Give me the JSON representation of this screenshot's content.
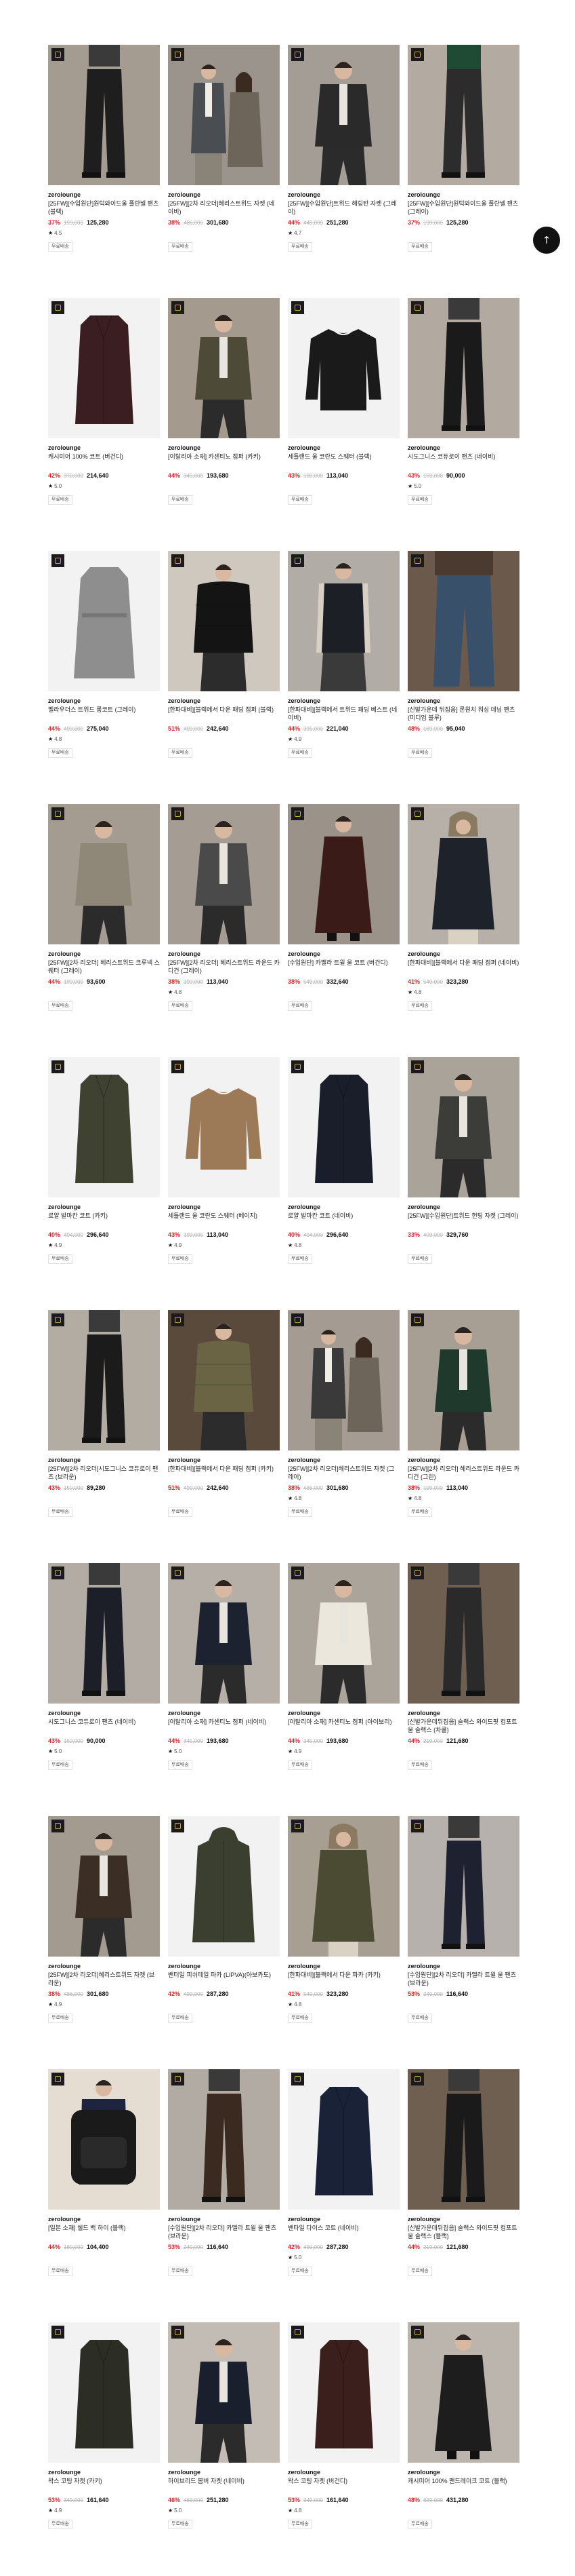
{
  "scroll_top": {
    "icon": "arrow-up-icon",
    "label": "↑"
  },
  "colors": {
    "discount": "#e0262b",
    "badge_bg": "#1b1b1b",
    "badge_border": "#c8a45a"
  },
  "products": [
    {
      "brand": "zerolounge",
      "name": "[25FW][수입원단]원턱와이드울 플란넬 팬츠 (블랙)",
      "discount": "37%",
      "original_price": "199,000",
      "price": "125,280",
      "rating": "4.5",
      "tag": "무료배송",
      "bg": "#a49c91",
      "garment": "pants-black",
      "fg": "#1e1e1e"
    },
    {
      "brand": "zerolounge",
      "name": "[25FW][2차 리오더]헤리스트위드 자켓 (네이비)",
      "discount": "38%",
      "original_price": "486,000",
      "price": "301,680",
      "rating": "",
      "tag": "무료배송",
      "bg": "#9a948c",
      "garment": "jacket-duo",
      "fg": "#4a4e53"
    },
    {
      "brand": "zerolounge",
      "name": "[25FW][수입원단]트위드 헤링턴 자켓 (그레이)",
      "discount": "44%",
      "original_price": "449,000",
      "price": "251,280",
      "rating": "4.7",
      "tag": "무료배송",
      "bg": "#a49d95",
      "garment": "jacket-dark",
      "fg": "#2a2a2a"
    },
    {
      "brand": "zerolounge",
      "name": "[25FW][수입원단]원턱와이드울 플란넬 팬츠 (그레이)",
      "discount": "37%",
      "original_price": "199,000",
      "price": "125,280",
      "rating": "",
      "tag": "무료배송",
      "bg": "#b3aba1",
      "garment": "pants-green",
      "fg": "#2c2c2c"
    },
    {
      "brand": "zerolounge",
      "name": "캐시미어 100% 코트 (버건디)",
      "discount": "42%",
      "original_price": "370,000",
      "price": "214,640",
      "rating": "5.0",
      "tag": "무료배송",
      "bg": "#f2f2f2",
      "garment": "coat-flat",
      "fg": "#3a1e22"
    },
    {
      "brand": "zerolounge",
      "name": "[이탈리아 소재] 카센티노 점퍼 (카키)",
      "discount": "44%",
      "original_price": "345,000",
      "price": "193,680",
      "rating": "",
      "tag": "무료배송",
      "bg": "#a49a8e",
      "garment": "jacket-model",
      "fg": "#4d4a37"
    },
    {
      "brand": "zerolounge",
      "name": "세틀랜드 울 코란도 스웨터 (블랙)",
      "discount": "43%",
      "original_price": "199,000",
      "price": "113,040",
      "rating": "",
      "tag": "무료배송",
      "bg": "#f2f2f2",
      "garment": "sweater-flat",
      "fg": "#1a1a1a"
    },
    {
      "brand": "zerolounge",
      "name": "시도그니스 코듀로이 팬츠 (네이비)",
      "discount": "43%",
      "original_price": "159,000",
      "price": "90,000",
      "rating": "5.0",
      "tag": "무료배송",
      "bg": "#b2aaa0",
      "garment": "pants-black",
      "fg": "#1a1a1a"
    },
    {
      "brand": "zerolounge",
      "name": "멜라우더스 트위드 롱코트 (그레이)",
      "discount": "44%",
      "original_price": "490,000",
      "price": "275,040",
      "rating": "4.8",
      "tag": "무료배송",
      "bg": "#f2f2f2",
      "garment": "coat-grey",
      "fg": "#8e8e8e"
    },
    {
      "brand": "zerolounge",
      "name": "[한파대비][블랙에서 다운 패딩 점퍼 (블랙)",
      "discount": "51%",
      "original_price": "499,000",
      "price": "242,640",
      "rating": "",
      "tag": "무료배송",
      "bg": "#cfc8be",
      "garment": "puffer-model",
      "fg": "#141414"
    },
    {
      "brand": "zerolounge",
      "name": "[한파대비][블랙에서 트위드 패딩 베스트 (네이비)",
      "discount": "44%",
      "original_price": "395,000",
      "price": "221,040",
      "rating": "4.9",
      "tag": "무료배송",
      "bg": "#b1aca5",
      "garment": "vest-model",
      "fg": "#1c1f26"
    },
    {
      "brand": "zerolounge",
      "name": "[신발가운데 뒤집음] 론원치 워싱 데님 팬츠 (미디엄 블루)",
      "discount": "48%",
      "original_price": "189,000",
      "price": "95,040",
      "rating": "",
      "tag": "무료배송",
      "bg": "#6b5a4b",
      "garment": "denim",
      "fg": "#39506b"
    },
    {
      "brand": "zerolounge",
      "name": "[25FW][2차 리오더] 헤리스트위드 크루넥 스웨터 (그레이)",
      "discount": "44%",
      "original_price": "199,000",
      "price": "93,600",
      "rating": "",
      "tag": "무료배송",
      "bg": "#a59c91",
      "garment": "sweater-model",
      "fg": "#8f8777"
    },
    {
      "brand": "zerolounge",
      "name": "[25FW][2차 리오더] 헤리스트위드 라운드 카디건 (그레이)",
      "discount": "38%",
      "original_price": "199,000",
      "price": "113,040",
      "rating": "4.8",
      "tag": "무료배송",
      "bg": "#a59d93",
      "garment": "cardigan-model",
      "fg": "#4a4a4a"
    },
    {
      "brand": "zerolounge",
      "name": "[수입원단] 카멜라 트윌 울 코트 (버건디)",
      "discount": "38%",
      "original_price": "549,000",
      "price": "332,640",
      "rating": "",
      "tag": "무료배송",
      "bg": "#9b938a",
      "garment": "coat-model",
      "fg": "#3b1b18"
    },
    {
      "brand": "zerolounge",
      "name": "[한파대비][블랙에서 다운 패딩 점퍼 (네이비)",
      "discount": "41%",
      "original_price": "549,000",
      "price": "323,280",
      "rating": "4.8",
      "tag": "무료배송",
      "bg": "#b6b0a8",
      "garment": "parka-model",
      "fg": "#1d222b"
    },
    {
      "brand": "zerolounge",
      "name": "로얄 발마칸 코트 (카키)",
      "discount": "40%",
      "original_price": "494,000",
      "price": "296,640",
      "rating": "4.9",
      "tag": "무료배송",
      "bg": "#f2f2f2",
      "garment": "coat-flat",
      "fg": "#3f4230"
    },
    {
      "brand": "zerolounge",
      "name": "세틀랜드 울 코란도 스웨터 (베이지)",
      "discount": "43%",
      "original_price": "199,000",
      "price": "113,040",
      "rating": "4.9",
      "tag": "무료배송",
      "bg": "#f2f2f2",
      "garment": "sweater-flat",
      "fg": "#9c7a58"
    },
    {
      "brand": "zerolounge",
      "name": "로얄 발마칸 코트 (네이비)",
      "discount": "40%",
      "original_price": "494,000",
      "price": "296,640",
      "rating": "4.8",
      "tag": "무료배송",
      "bg": "#f2f2f2",
      "garment": "coat-flat",
      "fg": "#1a1e2a"
    },
    {
      "brand": "zerolounge",
      "name": "[25FW][수입원단]트위드 헌팅 자켓 (그레이)",
      "discount": "33%",
      "original_price": "499,000",
      "price": "329,760",
      "rating": "",
      "tag": "무료배송",
      "bg": "#aaa39a",
      "garment": "jacket-model",
      "fg": "#3c3c38"
    },
    {
      "brand": "zerolounge",
      "name": "[25FW][2차 리오더]시도그니스 코듀로이 팬츠 (브라운)",
      "discount": "43%",
      "original_price": "159,000",
      "price": "89,280",
      "rating": "",
      "tag": "무료배송",
      "bg": "#b3aca3",
      "garment": "pants-black",
      "fg": "#1b1b1b"
    },
    {
      "brand": "zerolounge",
      "name": "[한파대비][블랙에서 다운 패딩 점퍼 (카키)",
      "discount": "51%",
      "original_price": "499,000",
      "price": "242,640",
      "rating": "",
      "tag": "무료배송",
      "bg": "#5a4a3c",
      "garment": "puffer-model",
      "fg": "#6a6444"
    },
    {
      "brand": "zerolounge",
      "name": "[25FW][2차 리오더]헤리스트위드 자켓 (그레이)",
      "discount": "38%",
      "original_price": "486,000",
      "price": "301,680",
      "rating": "4.8",
      "tag": "무료배송",
      "bg": "#a49c92",
      "garment": "jacket-duo",
      "fg": "#3a3a3a"
    },
    {
      "brand": "zerolounge",
      "name": "[25FW][2차 리오더] 헤리스트위드 라운드 카디건 (그린)",
      "discount": "38%",
      "original_price": "199,000",
      "price": "113,040",
      "rating": "4.8",
      "tag": "무료배송",
      "bg": "#a79f94",
      "garment": "cardigan-model",
      "fg": "#1f3a2c"
    },
    {
      "brand": "zerolounge",
      "name": "시도그니스 코듀로이 팬츠 (네이비)",
      "discount": "43%",
      "original_price": "159,000",
      "price": "90,000",
      "rating": "5.0",
      "tag": "무료배송",
      "bg": "#b3aca4",
      "garment": "pants-black",
      "fg": "#1c1f28"
    },
    {
      "brand": "zerolounge",
      "name": "[이탈리아 소재] 카센티노 점퍼 (네이비)",
      "discount": "44%",
      "original_price": "345,000",
      "price": "193,680",
      "rating": "5.0",
      "tag": "무료배송",
      "bg": "#b5afa7",
      "garment": "jacket-model",
      "fg": "#1d2230"
    },
    {
      "brand": "zerolounge",
      "name": "[이탈리아 소재] 카센티노 점퍼 (아이보리)",
      "discount": "44%",
      "original_price": "345,000",
      "price": "193,680",
      "rating": "4.9",
      "tag": "무료배송",
      "bg": "#aba49b",
      "garment": "jacket-model",
      "fg": "#ece7dd"
    },
    {
      "brand": "zerolounge",
      "name": "[신발가운데뒤집음] 슬랙스 와이드핏 컴포트 울 슬랙스 (차콜)",
      "discount": "44%",
      "original_price": "219,000",
      "price": "121,680",
      "rating": "",
      "tag": "무료배송",
      "bg": "#6e5f51",
      "garment": "pants-black",
      "fg": "#2a2a2a"
    },
    {
      "brand": "zerolounge",
      "name": "[25FW][2차 리오더]헤리스트위드 자켓 (브라운)",
      "discount": "38%",
      "original_price": "486,000",
      "price": "301,680",
      "rating": "4.9",
      "tag": "무료배송",
      "bg": "#a49b90",
      "garment": "jacket-model",
      "fg": "#3b2e24"
    },
    {
      "brand": "zerolounge",
      "name": "밴터일 피쉬테일 파카 (LIPVA)(아보카도)",
      "discount": "42%",
      "original_price": "490,000",
      "price": "287,280",
      "rating": "",
      "tag": "무료배송",
      "bg": "#f2f2f2",
      "garment": "parka-flat",
      "fg": "#3b3f30"
    },
    {
      "brand": "zerolounge",
      "name": "[한파대비][블랙에서 다운 파카 (카키)",
      "discount": "41%",
      "original_price": "549,000",
      "price": "323,280",
      "rating": "4.8",
      "tag": "무료배송",
      "bg": "#a89f93",
      "garment": "parka-model",
      "fg": "#4b4a33"
    },
    {
      "brand": "zerolounge",
      "name": "[수입원단][2차 리오더] 카멜라 트윌 울 팬츠 (브라운)",
      "discount": "53%",
      "original_price": "249,000",
      "price": "116,640",
      "rating": "",
      "tag": "무료배송",
      "bg": "#b6b1ac",
      "garment": "pants-black",
      "fg": "#1e2230"
    },
    {
      "brand": "zerolounge",
      "name": "[일본 소재] 쉘드 백 하이 (블랙)",
      "discount": "44%",
      "original_price": "189,000",
      "price": "104,400",
      "rating": "",
      "tag": "무료배송",
      "bg": "#e6ddd2",
      "garment": "backpack",
      "fg": "#1a1a1a"
    },
    {
      "brand": "zerolounge",
      "name": "[수입원단][2차 리오더] 카멜라 트윌 울 팬츠 (브라운)",
      "discount": "53%",
      "original_price": "249,000",
      "price": "116,640",
      "rating": "",
      "tag": "무료배송",
      "bg": "#b1aba4",
      "garment": "pants-black",
      "fg": "#3a2a20"
    },
    {
      "brand": "zerolounge",
      "name": "밴타일 다이스 코트 (네이비)",
      "discount": "42%",
      "original_price": "490,000",
      "price": "287,280",
      "rating": "5.0",
      "tag": "무료배송",
      "bg": "#f2f2f2",
      "garment": "coat-flat",
      "fg": "#1a2238"
    },
    {
      "brand": "zerolounge",
      "name": "[신발가운데뒤집음] 슬랙스 와이드핏 컴포트 울 슬랙스 (블랙)",
      "discount": "44%",
      "original_price": "219,000",
      "price": "121,680",
      "rating": "",
      "tag": "무료배송",
      "bg": "#6e5f51",
      "garment": "pants-black",
      "fg": "#1a1a1a"
    },
    {
      "brand": "zerolounge",
      "name": "왁스 코팅 자켓 (카키)",
      "discount": "53%",
      "original_price": "349,000",
      "price": "161,640",
      "rating": "4.9",
      "tag": "무료배송",
      "bg": "#f2f2f2",
      "garment": "coat-flat",
      "fg": "#2c2e26"
    },
    {
      "brand": "zerolounge",
      "name": "하이브리드 봄버 자켓 (네이비)",
      "discount": "46%",
      "original_price": "469,000",
      "price": "251,280",
      "rating": "5.0",
      "tag": "무료배송",
      "bg": "#c2bcb4",
      "garment": "jacket-model",
      "fg": "#1a1f2e"
    },
    {
      "brand": "zerolounge",
      "name": "왁스 코팅 자켓 (버건디)",
      "discount": "53%",
      "original_price": "349,000",
      "price": "161,640",
      "rating": "4.8",
      "tag": "무료배송",
      "bg": "#f2f2f2",
      "garment": "coat-flat",
      "fg": "#3a1f1c"
    },
    {
      "brand": "zerolounge",
      "name": "캐시미어 100% 맨드레이크 코트 (블랙)",
      "discount": "48%",
      "original_price": "829,000",
      "price": "431,280",
      "rating": "",
      "tag": "무료배송",
      "bg": "#bbb5ad",
      "garment": "coat-model",
      "fg": "#1d1d1d"
    }
  ]
}
